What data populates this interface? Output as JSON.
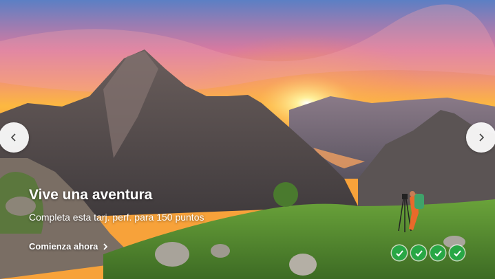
{
  "card": {
    "title": "Vive una aventura",
    "subtitle": "Completa esta tarj. perf. para 150 puntos",
    "cta_label": "Comienza ahora"
  },
  "navigation": {
    "prev_icon": "chevron-left-icon",
    "next_icon": "chevron-right-icon"
  },
  "progress": {
    "completed": 4,
    "total": 4,
    "check_color": "#28a745"
  }
}
